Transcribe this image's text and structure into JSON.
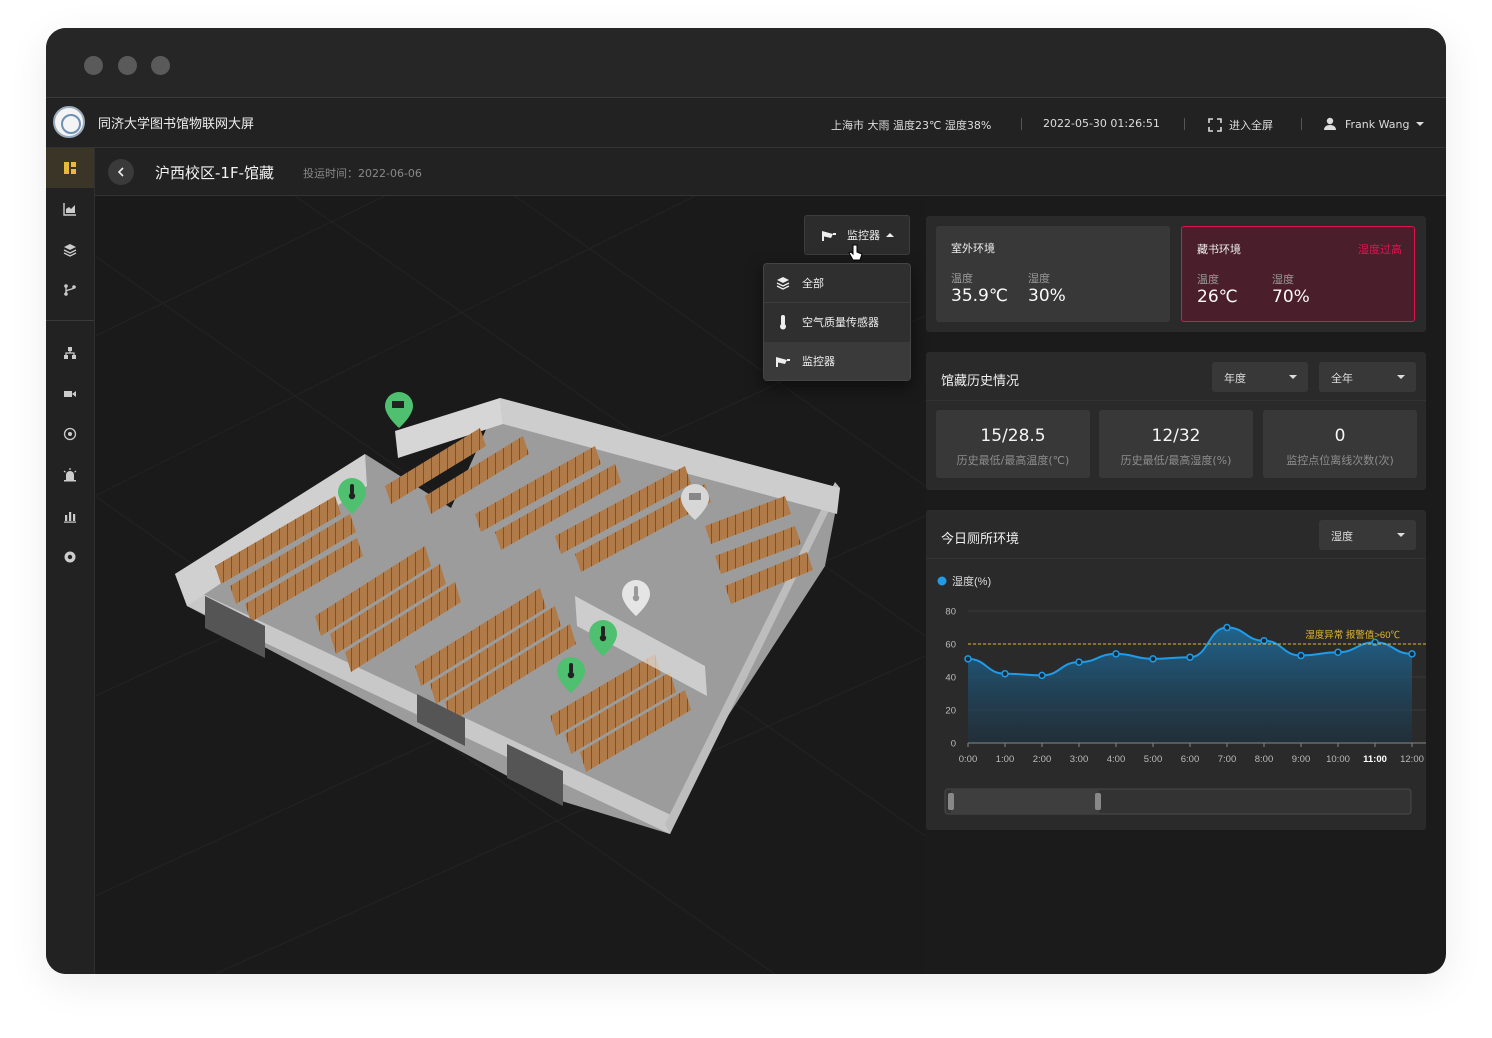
{
  "app": {
    "title": "同济大学图书馆物联网大屏"
  },
  "header": {
    "weather": "上海市 大雨 温度23℃ 湿度38%",
    "datetime": "2022-05-30 01:26:51",
    "fullscreen_label": "进入全屏",
    "user_name": "Frank Wang"
  },
  "sidebar": {
    "icons": [
      "dashboard-icon",
      "area-chart-icon",
      "layers-icon",
      "branch-icon",
      "org-chart-icon",
      "video-camera-icon",
      "radar-icon",
      "alarm-icon",
      "bar-chart-icon",
      "settings-icon"
    ]
  },
  "page": {
    "title": "沪西校区-1F-馆藏",
    "meta": "投运时间：2022-06-06"
  },
  "device_filter": {
    "selected": "监控器",
    "options": [
      {
        "label": "全部",
        "icon": "layers-icon"
      },
      {
        "label": "空气质量传感器",
        "icon": "thermometer-icon"
      },
      {
        "label": "监控器",
        "icon": "camera-icon"
      }
    ]
  },
  "environment": {
    "outdoor": {
      "title": "室外环境",
      "temp_label": "温度",
      "temp": "35.9℃",
      "hum_label": "湿度",
      "hum": "30%"
    },
    "collection": {
      "title": "藏书环境",
      "warning": "湿度过高",
      "temp_label": "温度",
      "temp": "26℃",
      "hum_label": "湿度",
      "hum": "70%"
    }
  },
  "history": {
    "title": "馆藏历史情况",
    "period": "年度",
    "range": "全年",
    "stats": [
      {
        "value": "15/28.5",
        "label": "历史最低/最高温度(℃)"
      },
      {
        "value": "12/32",
        "label": "历史最低/最高湿度(%)"
      },
      {
        "value": "0",
        "label": "监控点位离线次数(次)"
      }
    ]
  },
  "today": {
    "title": "今日厕所环境",
    "metric": "湿度"
  },
  "chart_data": {
    "type": "area",
    "series": [
      {
        "name": "湿度(%)",
        "values": [
          51,
          42,
          41,
          49,
          54,
          51,
          52,
          70,
          62,
          53,
          55,
          61,
          54
        ]
      }
    ],
    "x": [
      "0:00",
      "1:00",
      "2:00",
      "3:00",
      "4:00",
      "5:00",
      "6:00",
      "7:00",
      "8:00",
      "9:00",
      "10:00",
      "11:00",
      "12:00"
    ],
    "ylim": [
      0,
      80
    ],
    "yticks": [
      0,
      20,
      40,
      60,
      80
    ],
    "threshold": {
      "value": 60,
      "label": "湿度异常 报警值>60℃"
    },
    "highlight_tick": "11:00",
    "colors": {
      "line": "#1f9be8",
      "threshold": "#e6b82e"
    }
  }
}
